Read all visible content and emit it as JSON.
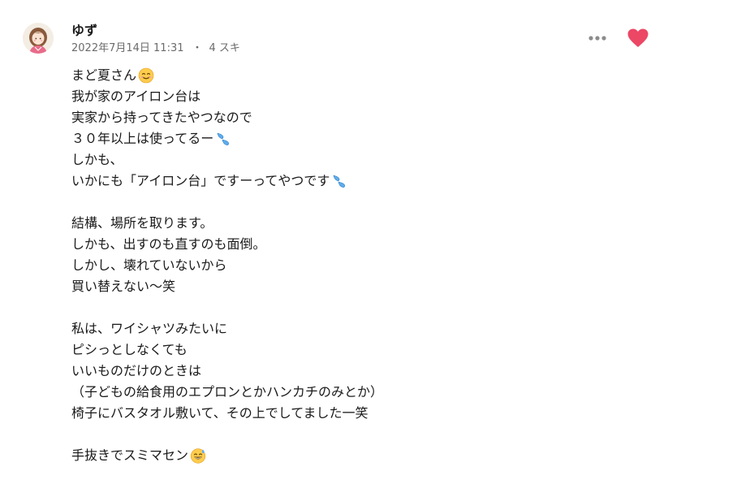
{
  "comment": {
    "author": "ゆず",
    "date": "2022年7月14日 11:31",
    "separator": "・",
    "likes": "4 スキ",
    "liked": true,
    "like_color": "#ec4765",
    "lines": [
      {
        "text": "まど夏さん",
        "emoji": "smiling-face-icon"
      },
      {
        "text": "我が家のアイロン台は"
      },
      {
        "text": "実家から持ってきたやつなので"
      },
      {
        "text": "３０年以上は使ってるー",
        "emoji": "sweat-droplets-icon"
      },
      {
        "text": "しかも、"
      },
      {
        "text": "いかにも「アイロン台」ですーってやつです",
        "emoji": "sweat-droplets-icon"
      },
      {
        "text": ""
      },
      {
        "text": "結構、場所を取ります。"
      },
      {
        "text": "しかも、出すのも直すのも面倒。"
      },
      {
        "text": "しかし、壊れていないから"
      },
      {
        "text": "買い替えない〜笑"
      },
      {
        "text": ""
      },
      {
        "text": "私は、ワイシャツみたいに"
      },
      {
        "text": "ピシっとしなくても"
      },
      {
        "text": "いいものだけのときは"
      },
      {
        "text": "（子どもの給食用のエプロンとかハンカチのみとか）"
      },
      {
        "text": "椅子にバスタオル敷いて、その上でしてました一笑"
      },
      {
        "text": ""
      },
      {
        "text": "手抜きでスミマセン",
        "emoji": "grinning-sweat-icon"
      }
    ]
  }
}
